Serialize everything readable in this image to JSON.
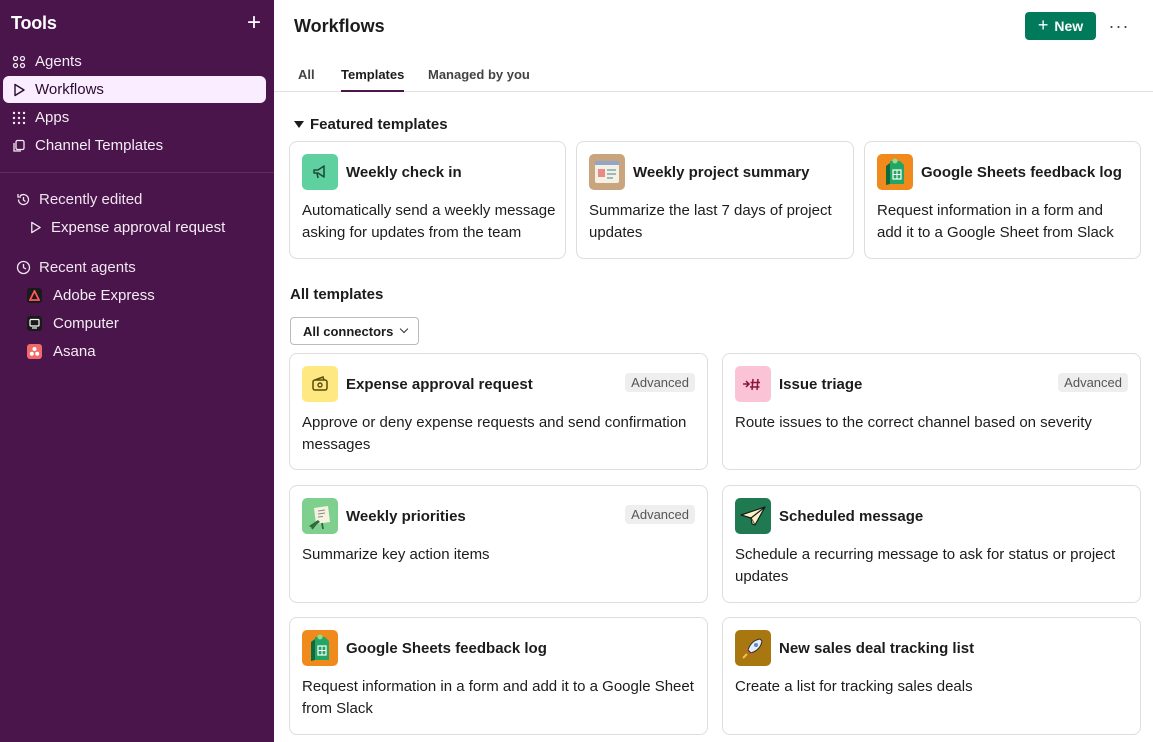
{
  "sidebar": {
    "title": "Tools",
    "add_label": "+",
    "nav": [
      {
        "label": "Agents",
        "icon": "agents-icon"
      },
      {
        "label": "Workflows",
        "icon": "play-icon",
        "active": true
      },
      {
        "label": "Apps",
        "icon": "grid-icon"
      },
      {
        "label": "Channel Templates",
        "icon": "copy-icon"
      }
    ],
    "recently_edited": {
      "label": "Recently edited",
      "items": [
        {
          "label": "Expense approval request"
        }
      ]
    },
    "recent_agents": {
      "label": "Recent agents",
      "items": [
        {
          "label": "Adobe Express",
          "color": "#1a1a1a"
        },
        {
          "label": "Computer",
          "color": "#1a1a1a"
        },
        {
          "label": "Asana",
          "color": "#f06a6a"
        }
      ]
    }
  },
  "header": {
    "title": "Workflows",
    "new_label": "New",
    "more_label": "···"
  },
  "tabs": [
    {
      "label": "All",
      "active": false
    },
    {
      "label": "Templates",
      "active": true
    },
    {
      "label": "Managed by you",
      "active": false
    }
  ],
  "featured": {
    "heading": "Featured templates",
    "cards": [
      {
        "title": "Weekly check in",
        "desc": "Automatically send a weekly message asking for updates from the team",
        "icon": "megaphone-icon",
        "color": "#5fd0a0"
      },
      {
        "title": "Weekly project summary",
        "desc": "Summarize the last 7 days of project updates",
        "icon": "document-icon",
        "color": "#c9a57f"
      },
      {
        "title": "Google Sheets feedback log",
        "desc": "Request information in a form and add it to a Google Sheet from Slack",
        "icon": "sheets-icon",
        "color": "#f08a1d"
      }
    ]
  },
  "all_templates": {
    "heading": "All templates",
    "filter_label": "All connectors",
    "cards": [
      {
        "title": "Expense approval request",
        "desc": "Approve or deny expense requests and send confirmation messages",
        "badge": "Advanced",
        "icon": "wallet-icon",
        "color": "#fde882"
      },
      {
        "title": "Issue triage",
        "desc": "Route issues to the correct channel based on severity",
        "badge": "Advanced",
        "icon": "hash-icon",
        "color": "#fbc4d6"
      },
      {
        "title": "Weekly priorities",
        "desc": "Summarize key action items",
        "badge": "Advanced",
        "icon": "easel-icon",
        "color": "#7fcf8f"
      },
      {
        "title": "Scheduled message",
        "desc": "Schedule a recurring message to ask for status or project updates",
        "badge": "",
        "icon": "paper-plane-icon",
        "color": "#1f7a52"
      },
      {
        "title": "Google Sheets feedback log",
        "desc": "Request information in a form and add it to a Google Sheet from Slack",
        "badge": "",
        "icon": "sheets-icon",
        "color": "#f08a1d"
      },
      {
        "title": "New sales deal tracking list",
        "desc": "Create a list for tracking sales deals",
        "badge": "",
        "icon": "rocket-icon",
        "color": "#a8770f"
      }
    ]
  }
}
